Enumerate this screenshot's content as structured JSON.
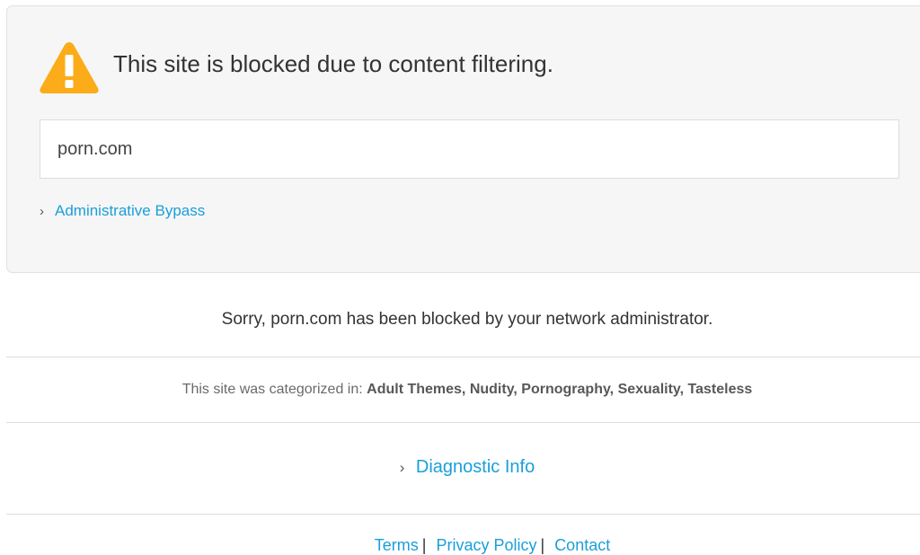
{
  "block_panel": {
    "headline": "This site is blocked due to content filtering.",
    "domain": "porn.com",
    "bypass_label": "Administrative Bypass",
    "warning_icon_color": "#fbac18"
  },
  "message": "Sorry, porn.com has been blocked by your network administrator.",
  "categorized": {
    "prefix": "This site was categorized in:",
    "categories": "Adult Themes, Nudity, Pornography, Sexuality, Tasteless"
  },
  "diagnostic_label": "Diagnostic Info",
  "footer": {
    "links": [
      "Terms",
      "Privacy Policy",
      "Contact"
    ],
    "separator": "|"
  },
  "colors": {
    "link": "#1a9fd9",
    "panel_bg": "#f6f6f6",
    "text": "#333333"
  },
  "icons": {
    "warning": "warning-triangle-icon",
    "expand": "chevron-right-icon"
  }
}
